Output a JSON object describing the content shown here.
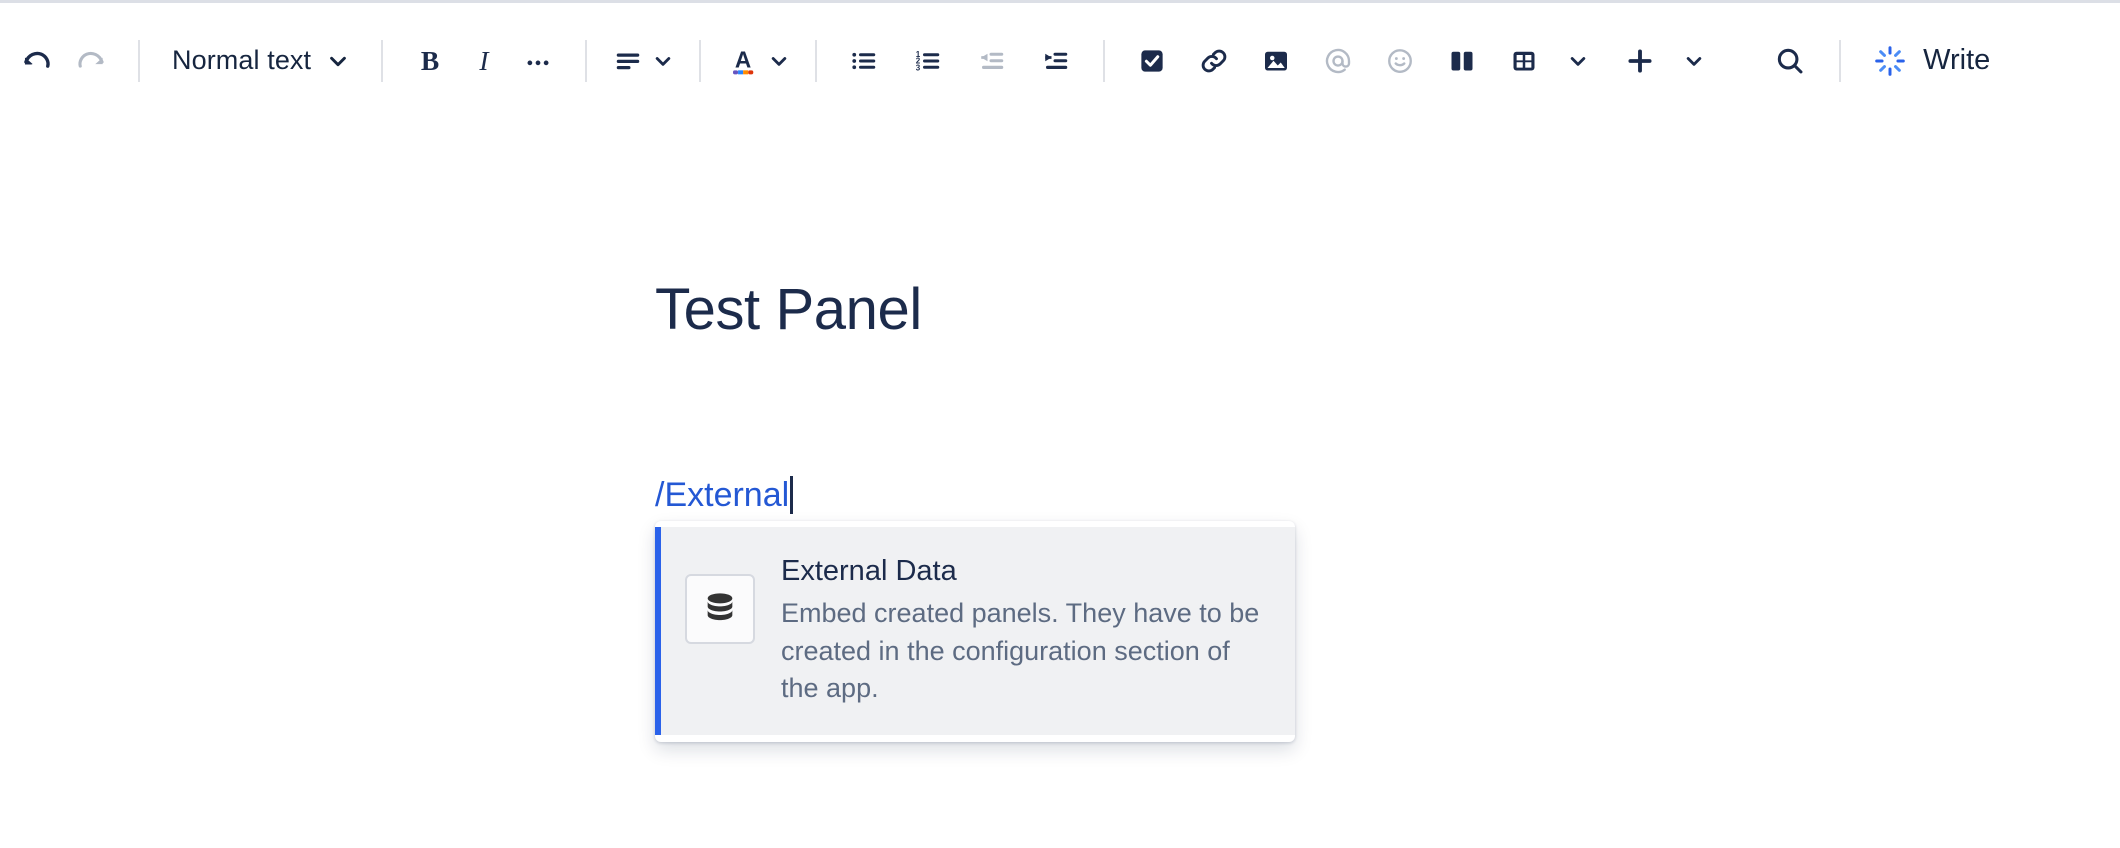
{
  "toolbar": {
    "undo": {
      "label": "Undo",
      "icon": "undo-icon",
      "disabled": false
    },
    "redo": {
      "label": "Redo",
      "icon": "redo-icon",
      "disabled": true
    },
    "text_style": {
      "value": "Normal text",
      "icon": "chevron-down-icon"
    },
    "bold": {
      "label": "Bold",
      "icon": "bold-icon"
    },
    "italic": {
      "label": "Italic",
      "icon": "italic-icon"
    },
    "more_formatting": {
      "label": "More formatting",
      "icon": "ellipsis-icon"
    },
    "text_align": {
      "label": "Text alignment",
      "icon": "align-left-icon"
    },
    "text_color": {
      "label": "Text color",
      "icon": "text-color-icon"
    },
    "bullet_list": {
      "label": "Bulleted list",
      "icon": "bullet-list-icon"
    },
    "numbered_list": {
      "label": "Numbered list",
      "icon": "numbered-list-icon"
    },
    "outdent": {
      "label": "Outdent",
      "icon": "outdent-icon",
      "disabled": true
    },
    "indent": {
      "label": "Indent",
      "icon": "indent-icon"
    },
    "task_list": {
      "label": "Action item",
      "icon": "checkbox-icon"
    },
    "link": {
      "label": "Link",
      "icon": "link-icon"
    },
    "image": {
      "label": "Image",
      "icon": "image-icon"
    },
    "mention": {
      "label": "Mention",
      "icon": "mention-icon",
      "disabled": true
    },
    "emoji": {
      "label": "Emoji",
      "icon": "emoji-icon",
      "disabled": true
    },
    "layout": {
      "label": "Layouts",
      "icon": "two-column-layout-icon"
    },
    "table": {
      "label": "Table",
      "icon": "table-icon"
    },
    "table_more": {
      "label": "Table options",
      "icon": "chevron-down-icon"
    },
    "insert": {
      "label": "Insert",
      "icon": "plus-icon"
    },
    "insert_more": {
      "label": "Insert options",
      "icon": "chevron-down-icon"
    },
    "find": {
      "label": "Find and replace",
      "icon": "search-icon"
    },
    "ai_write": {
      "label": "Write",
      "icon": "ai-sparkle-icon"
    },
    "colors": {
      "icon": "#1c2b4b",
      "icon_disabled": "#b3bac5",
      "accent_blue": "#2a62ea",
      "swatches": [
        "#6554c0",
        "#2684ff",
        "#ff8b00",
        "#de350b"
      ]
    }
  },
  "document": {
    "title": "Test Panel",
    "body_text": "/External"
  },
  "command_popup": {
    "items": [
      {
        "title": "External Data",
        "description": "Embed created panels. They have to be created in the configuration section of the app.",
        "icon": "database-icon",
        "selected": true
      }
    ]
  }
}
